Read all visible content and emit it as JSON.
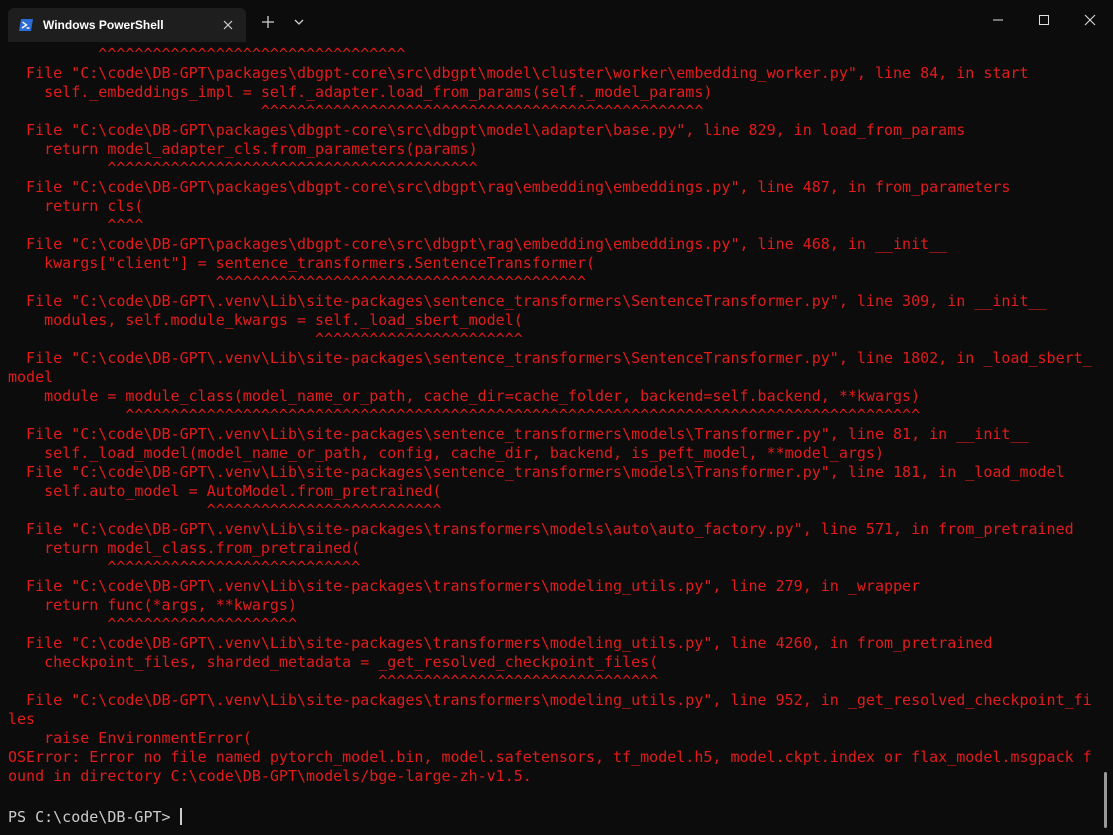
{
  "tab": {
    "title": "Windows PowerShell",
    "icon": "powershell-icon"
  },
  "colors": {
    "error_text": "#e21b1b",
    "prompt_text": "#cccccc",
    "background": "#0c0c0c"
  },
  "terminal": {
    "lines": [
      "          ^^^^^^^^^^^^^^^^^^^^^^^^^^^^^^^^^^",
      "  File \"C:\\code\\DB-GPT\\packages\\dbgpt-core\\src\\dbgpt\\model\\cluster\\worker\\embedding_worker.py\", line 84, in start",
      "    self._embeddings_impl = self._adapter.load_from_params(self._model_params)",
      "                            ^^^^^^^^^^^^^^^^^^^^^^^^^^^^^^^^^^^^^^^^^^^^^^^^^",
      "  File \"C:\\code\\DB-GPT\\packages\\dbgpt-core\\src\\dbgpt\\model\\adapter\\base.py\", line 829, in load_from_params",
      "    return model_adapter_cls.from_parameters(params)",
      "           ^^^^^^^^^^^^^^^^^^^^^^^^^^^^^^^^^^^^^^^^^",
      "  File \"C:\\code\\DB-GPT\\packages\\dbgpt-core\\src\\dbgpt\\rag\\embedding\\embeddings.py\", line 487, in from_parameters",
      "    return cls(",
      "           ^^^^",
      "  File \"C:\\code\\DB-GPT\\packages\\dbgpt-core\\src\\dbgpt\\rag\\embedding\\embeddings.py\", line 468, in __init__",
      "    kwargs[\"client\"] = sentence_transformers.SentenceTransformer(",
      "                       ^^^^^^^^^^^^^^^^^^^^^^^^^^^^^^^^^^^^^^^^^",
      "  File \"C:\\code\\DB-GPT\\.venv\\Lib\\site-packages\\sentence_transformers\\SentenceTransformer.py\", line 309, in __init__",
      "    modules, self.module_kwargs = self._load_sbert_model(",
      "                                  ^^^^^^^^^^^^^^^^^^^^^^^",
      "  File \"C:\\code\\DB-GPT\\.venv\\Lib\\site-packages\\sentence_transformers\\SentenceTransformer.py\", line 1802, in _load_sbert_",
      "model",
      "    module = module_class(model_name_or_path, cache_dir=cache_folder, backend=self.backend, **kwargs)",
      "             ^^^^^^^^^^^^^^^^^^^^^^^^^^^^^^^^^^^^^^^^^^^^^^^^^^^^^^^^^^^^^^^^^^^^^^^^^^^^^^^^^^^^^^^^",
      "  File \"C:\\code\\DB-GPT\\.venv\\Lib\\site-packages\\sentence_transformers\\models\\Transformer.py\", line 81, in __init__",
      "    self._load_model(model_name_or_path, config, cache_dir, backend, is_peft_model, **model_args)",
      "  File \"C:\\code\\DB-GPT\\.venv\\Lib\\site-packages\\sentence_transformers\\models\\Transformer.py\", line 181, in _load_model",
      "    self.auto_model = AutoModel.from_pretrained(",
      "                      ^^^^^^^^^^^^^^^^^^^^^^^^^^",
      "  File \"C:\\code\\DB-GPT\\.venv\\Lib\\site-packages\\transformers\\models\\auto\\auto_factory.py\", line 571, in from_pretrained",
      "    return model_class.from_pretrained(",
      "           ^^^^^^^^^^^^^^^^^^^^^^^^^^^^",
      "  File \"C:\\code\\DB-GPT\\.venv\\Lib\\site-packages\\transformers\\modeling_utils.py\", line 279, in _wrapper",
      "    return func(*args, **kwargs)",
      "           ^^^^^^^^^^^^^^^^^^^^^",
      "  File \"C:\\code\\DB-GPT\\.venv\\Lib\\site-packages\\transformers\\modeling_utils.py\", line 4260, in from_pretrained",
      "    checkpoint_files, sharded_metadata = _get_resolved_checkpoint_files(",
      "                                         ^^^^^^^^^^^^^^^^^^^^^^^^^^^^^^^",
      "  File \"C:\\code\\DB-GPT\\.venv\\Lib\\site-packages\\transformers\\modeling_utils.py\", line 952, in _get_resolved_checkpoint_fi",
      "les",
      "    raise EnvironmentError(",
      "OSError: Error no file named pytorch_model.bin, model.safetensors, tf_model.h5, model.ckpt.index or flax_model.msgpack f",
      "ound in directory C:\\code\\DB-GPT\\models/bge-large-zh-v1.5."
    ],
    "prompt": "PS C:\\code\\DB-GPT>"
  }
}
